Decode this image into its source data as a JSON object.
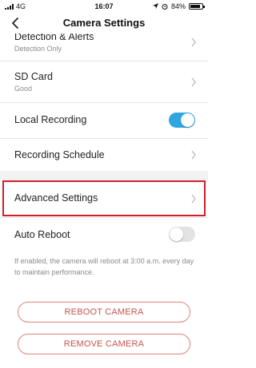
{
  "status_bar": {
    "carrier": "4G",
    "time": "16:07",
    "battery": "84%",
    "battery_level": 0.84
  },
  "nav": {
    "title": "Camera Settings",
    "back_icon": "chevron-left-icon"
  },
  "rows": {
    "detection": {
      "label": "Detection & Alerts",
      "sub": "Detection Only"
    },
    "sd_card": {
      "label": "SD Card",
      "sub": "Good"
    },
    "local_recording": {
      "label": "Local Recording",
      "enabled": true
    },
    "recording_schedule": {
      "label": "Recording Schedule"
    },
    "advanced_settings": {
      "label": "Advanced Settings"
    },
    "auto_reboot": {
      "label": "Auto Reboot",
      "enabled": false
    }
  },
  "note": "If enabled, the camera will reboot at 3:00 a.m. every day to maintain performance.",
  "buttons": {
    "reboot": "REBOOT CAMERA",
    "remove": "REMOVE CAMERA"
  },
  "colors": {
    "toggle_on": "#2fa6e0",
    "toggle_off": "#e3e3e3",
    "highlight": "#d11f2a",
    "button_text": "#c6544c",
    "button_border": "#d9847e"
  }
}
